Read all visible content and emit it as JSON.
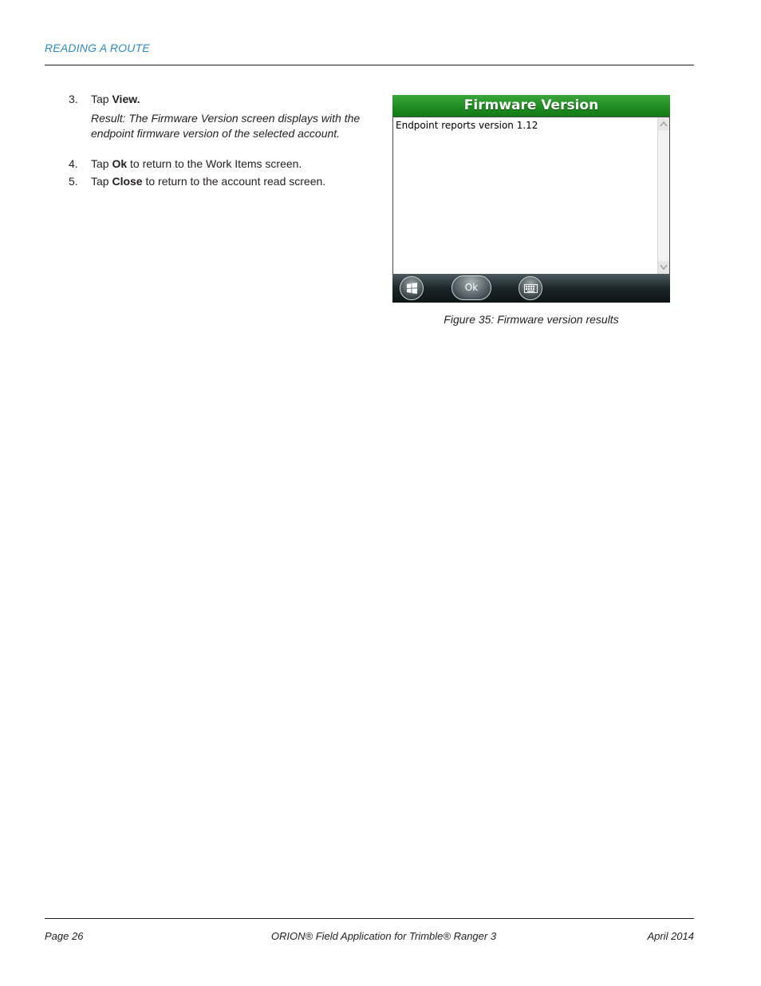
{
  "header": {
    "section_title": "READING A ROUTE"
  },
  "steps": [
    {
      "num": "3.",
      "prefix": "Tap ",
      "bold": "View.",
      "suffix": ""
    },
    {
      "num": "4.",
      "prefix": "Tap ",
      "bold": "Ok",
      "suffix": " to return to the Work Items screen."
    },
    {
      "num": "5.",
      "prefix": "Tap ",
      "bold": "Close",
      "suffix": " to return to the account read screen."
    }
  ],
  "result_text": "Result: The Firmware Version screen displays with the endpoint firmware version of the selected account.",
  "device": {
    "title": "Firmware Version",
    "content_text": "Endpoint reports version 1.12",
    "ok_label": "Ok",
    "scroll_up_glyph": "^",
    "scroll_down_glyph": "v",
    "title_color": "#1f8a21"
  },
  "figure_caption": "Figure 35:  Firmware version results",
  "footer": {
    "page": "Page 26",
    "doc_title": "ORION® Field Application for Trimble® Ranger 3",
    "date": "April 2014"
  }
}
